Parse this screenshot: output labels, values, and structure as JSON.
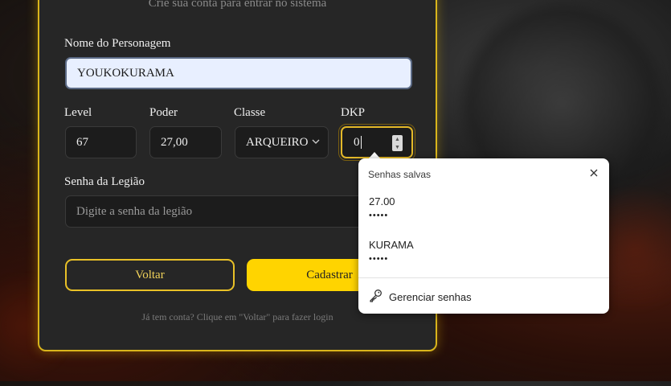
{
  "form": {
    "subtitle": "Crie sua conta para entrar no sistema",
    "character_name_label": "Nome do Personagem",
    "character_name_value": "YOUKOKURAMA",
    "level_label": "Level",
    "level_value": "67",
    "power_label": "Poder",
    "power_value": "27,00",
    "class_label": "Classe",
    "class_value": "ARQUEIRO",
    "dkp_label": "DKP",
    "dkp_value": "0",
    "legion_password_label": "Senha da Legião",
    "legion_password_placeholder": "Digite a senha da legião",
    "back_button": "Voltar",
    "register_button": "Cadastrar",
    "footer": "Já tem conta? Clique em \"Voltar\" para fazer login"
  },
  "saved_passwords_popup": {
    "title": "Senhas salvas",
    "entries": [
      {
        "username": "27.00",
        "password_mask": "•••••"
      },
      {
        "username": "KURAMA",
        "password_mask": "•••••"
      }
    ],
    "manage_label": "Gerenciar senhas"
  },
  "colors": {
    "accent": "#ffd400",
    "border_gold": "#d9b51c",
    "card_bg": "#262626",
    "input_bg": "#1c1c1c"
  }
}
